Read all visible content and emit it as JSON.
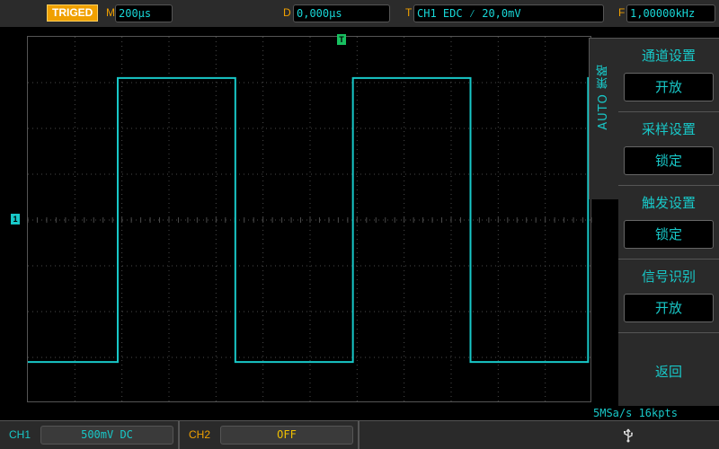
{
  "topbar": {
    "trig_status": "TRIGED",
    "timebase_label": "M",
    "timebase_value": "200µs",
    "delay_label": "D",
    "delay_value": "0,000µs",
    "trigger_label": "T",
    "trigger_value": "CH1 EDC ⁄ 20,0mV",
    "freq_label": "F",
    "freq_value": "1,00000kHz"
  },
  "markers": {
    "trigger_position": "T",
    "ch1_ground": "1"
  },
  "side_tab": {
    "label": "AUTO 策略"
  },
  "menu": {
    "items": [
      {
        "title": "通道设置",
        "value": "开放"
      },
      {
        "title": "采样设置",
        "value": "锁定"
      },
      {
        "title": "触发设置",
        "value": "锁定"
      },
      {
        "title": "信号识别",
        "value": "开放"
      }
    ],
    "return_label": "返回"
  },
  "status": {
    "sample_info": "5MSa/s 16kpts"
  },
  "bottombar": {
    "ch1_label": "CH1",
    "ch1_value": "500mV DC",
    "ch2_label": "CH2",
    "ch2_value": "OFF",
    "usb_icon": "usb-icon"
  },
  "colors": {
    "trace": "#18c8c8",
    "accent": "#f0a000",
    "grid": "#4a4a4a"
  },
  "waveform": {
    "type": "square",
    "high_level_div": 3.1,
    "low_level_div": -3.1,
    "edges_div": [
      0.0,
      2.5,
      5.0,
      7.5,
      10.0,
      12.5
    ],
    "start_level": "low"
  }
}
